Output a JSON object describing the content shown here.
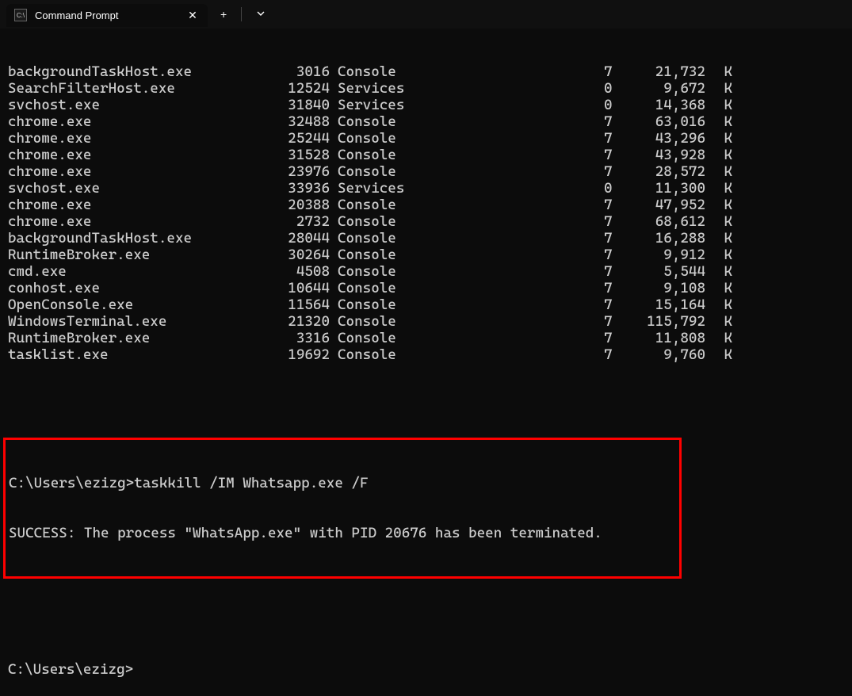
{
  "tab": {
    "title": "Command Prompt",
    "icon_glyph": "C:\\"
  },
  "processes": [
    {
      "name": "backgroundTaskHost.exe",
      "pid": "3016",
      "session": "Console",
      "sessnum": "7",
      "mem": "21,732",
      "unit": "K"
    },
    {
      "name": "SearchFilterHost.exe",
      "pid": "12524",
      "session": "Services",
      "sessnum": "0",
      "mem": "9,672",
      "unit": "K"
    },
    {
      "name": "svchost.exe",
      "pid": "31840",
      "session": "Services",
      "sessnum": "0",
      "mem": "14,368",
      "unit": "K"
    },
    {
      "name": "chrome.exe",
      "pid": "32488",
      "session": "Console",
      "sessnum": "7",
      "mem": "63,016",
      "unit": "K"
    },
    {
      "name": "chrome.exe",
      "pid": "25244",
      "session": "Console",
      "sessnum": "7",
      "mem": "43,296",
      "unit": "K"
    },
    {
      "name": "chrome.exe",
      "pid": "31528",
      "session": "Console",
      "sessnum": "7",
      "mem": "43,928",
      "unit": "K"
    },
    {
      "name": "chrome.exe",
      "pid": "23976",
      "session": "Console",
      "sessnum": "7",
      "mem": "28,572",
      "unit": "K"
    },
    {
      "name": "svchost.exe",
      "pid": "33936",
      "session": "Services",
      "sessnum": "0",
      "mem": "11,300",
      "unit": "K"
    },
    {
      "name": "chrome.exe",
      "pid": "20388",
      "session": "Console",
      "sessnum": "7",
      "mem": "47,952",
      "unit": "K"
    },
    {
      "name": "chrome.exe",
      "pid": "2732",
      "session": "Console",
      "sessnum": "7",
      "mem": "68,612",
      "unit": "K"
    },
    {
      "name": "backgroundTaskHost.exe",
      "pid": "28044",
      "session": "Console",
      "sessnum": "7",
      "mem": "16,288",
      "unit": "K"
    },
    {
      "name": "RuntimeBroker.exe",
      "pid": "30264",
      "session": "Console",
      "sessnum": "7",
      "mem": "9,912",
      "unit": "K"
    },
    {
      "name": "cmd.exe",
      "pid": "4508",
      "session": "Console",
      "sessnum": "7",
      "mem": "5,544",
      "unit": "K"
    },
    {
      "name": "conhost.exe",
      "pid": "10644",
      "session": "Console",
      "sessnum": "7",
      "mem": "9,108",
      "unit": "K"
    },
    {
      "name": "OpenConsole.exe",
      "pid": "11564",
      "session": "Console",
      "sessnum": "7",
      "mem": "15,164",
      "unit": "K"
    },
    {
      "name": "WindowsTerminal.exe",
      "pid": "21320",
      "session": "Console",
      "sessnum": "7",
      "mem": "115,792",
      "unit": "K"
    },
    {
      "name": "RuntimeBroker.exe",
      "pid": "3316",
      "session": "Console",
      "sessnum": "7",
      "mem": "11,808",
      "unit": "K"
    },
    {
      "name": "tasklist.exe",
      "pid": "19692",
      "session": "Console",
      "sessnum": "7",
      "mem": "9,760",
      "unit": "K"
    }
  ],
  "highlighted": {
    "command_line": "C:\\Users\\ezizg>taskkill /IM Whatsapp.exe /F",
    "result_line": "SUCCESS: The process \"WhatsApp.exe\" with PID 20676 has been terminated."
  },
  "prompt": "C:\\Users\\ezizg>"
}
